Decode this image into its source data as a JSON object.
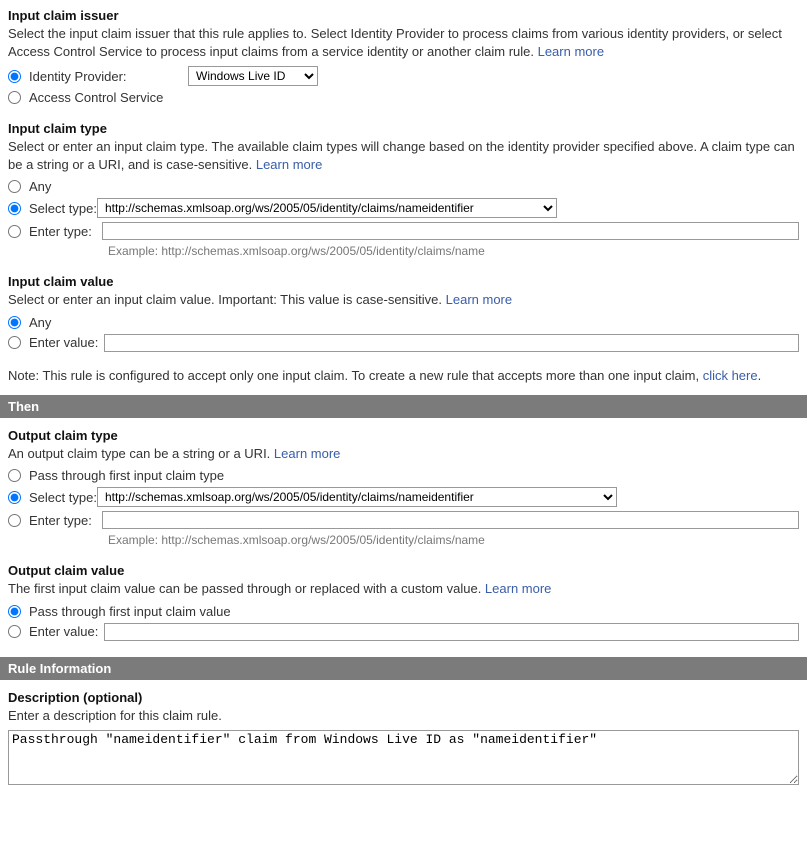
{
  "issuer": {
    "heading": "Input claim issuer",
    "desc": "Select the input claim issuer that this rule applies to. Select Identity Provider to process claims from various identity providers, or select Access Control Service to process input claims from a service identity or another claim rule. ",
    "learn": "Learn more",
    "opt_idp": "Identity Provider:",
    "opt_acs": "Access Control Service",
    "idp_selected": "Windows Live ID"
  },
  "input_type": {
    "heading": "Input claim type",
    "desc": "Select or enter an input claim type. The available claim types will change based on the identity provider specified above. A claim type can be a string or a URI, and is case-sensitive. ",
    "learn": "Learn more",
    "opt_any": "Any",
    "opt_select": "Select type:",
    "opt_enter": "Enter type:",
    "select_value": "http://schemas.xmlsoap.org/ws/2005/05/identity/claims/nameidentifier",
    "example": "Example: http://schemas.xmlsoap.org/ws/2005/05/identity/claims/name"
  },
  "input_value": {
    "heading": "Input claim value",
    "desc": "Select or enter an input claim value. Important: This value is case-sensitive. ",
    "learn": "Learn more",
    "opt_any": "Any",
    "opt_enter": "Enter value:"
  },
  "note": {
    "text": "Note: This rule is configured to accept only one input claim. To create a new rule that accepts more than one input claim, ",
    "link": "click here",
    "suffix": "."
  },
  "then_bar": "Then",
  "output_type": {
    "heading": "Output claim type",
    "desc": "An output claim type can be a string or a URI. ",
    "learn": "Learn more",
    "opt_pass": "Pass through first input claim type",
    "opt_select": "Select type:",
    "opt_enter": "Enter type:",
    "select_value": "http://schemas.xmlsoap.org/ws/2005/05/identity/claims/nameidentifier",
    "example": "Example: http://schemas.xmlsoap.org/ws/2005/05/identity/claims/name"
  },
  "output_value": {
    "heading": "Output claim value",
    "desc": "The first input claim value can be passed through or replaced with a custom value. ",
    "learn": "Learn more",
    "opt_pass": "Pass through first input claim value",
    "opt_enter": "Enter value:"
  },
  "rule_bar": "Rule Information",
  "description": {
    "heading": "Description (optional)",
    "desc": "Enter a description for this claim rule.",
    "value": "Passthrough \"nameidentifier\" claim from Windows Live ID as \"nameidentifier\""
  }
}
